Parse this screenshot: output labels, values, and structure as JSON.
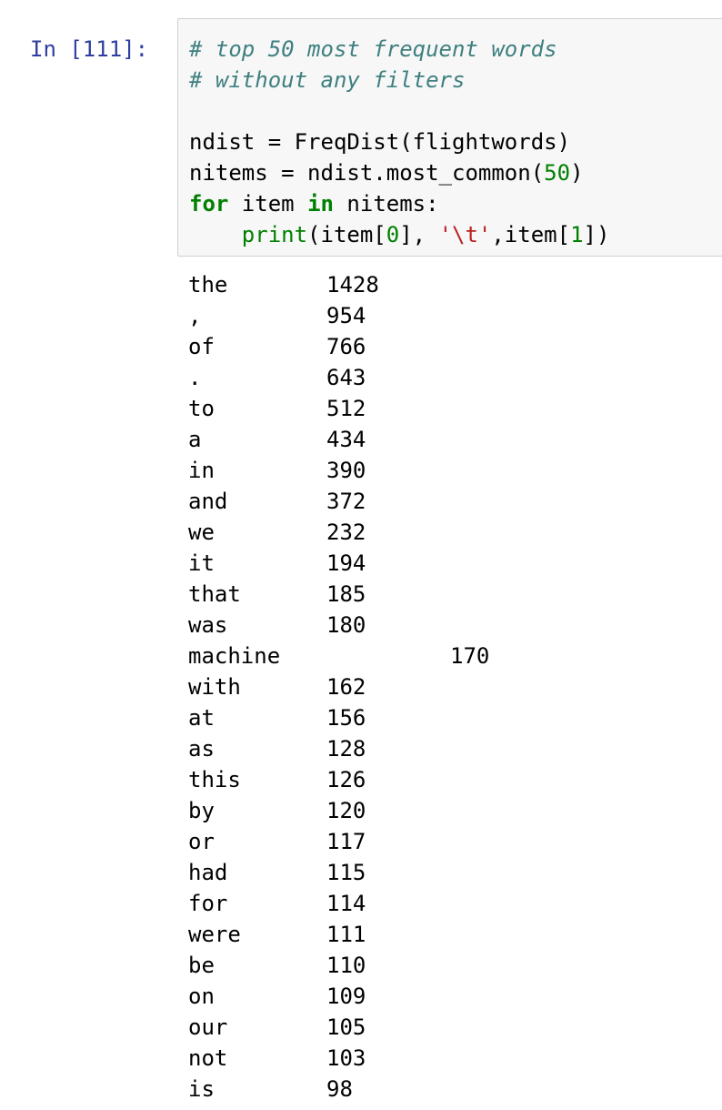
{
  "prompt": "In [111]:",
  "code": {
    "line1": "# top 50 most frequent words",
    "line2": "# without any filters",
    "line4_a": "ndist ",
    "line4_op": "=",
    "line4_b": " FreqDist(flightwords)",
    "line5_a": "nitems ",
    "line5_op": "=",
    "line5_b": " ndist.most_common(",
    "line5_num": "50",
    "line5_c": ")",
    "line6_kw1": "for",
    "line6_a": " item ",
    "line6_kw2": "in",
    "line6_b": " nitems:",
    "line7_indent": "    ",
    "line7_builtin": "print",
    "line7_a": "(item[",
    "line7_num1": "0",
    "line7_b": "], ",
    "line7_str": "'\\t'",
    "line7_c": ",item[",
    "line7_num2": "1",
    "line7_d": "])"
  },
  "output": [
    {
      "word": "the",
      "count": "1428"
    },
    {
      "word": ",",
      "count": "954"
    },
    {
      "word": "of",
      "count": "766"
    },
    {
      "word": ".",
      "count": "643"
    },
    {
      "word": "to",
      "count": "512"
    },
    {
      "word": "a",
      "count": "434"
    },
    {
      "word": "in",
      "count": "390"
    },
    {
      "word": "and",
      "count": "372"
    },
    {
      "word": "we",
      "count": "232"
    },
    {
      "word": "it",
      "count": "194"
    },
    {
      "word": "that",
      "count": "185"
    },
    {
      "word": "was",
      "count": "180"
    },
    {
      "word": "machine",
      "count": "170"
    },
    {
      "word": "with",
      "count": "162"
    },
    {
      "word": "at",
      "count": "156"
    },
    {
      "word": "as",
      "count": "128"
    },
    {
      "word": "this",
      "count": "126"
    },
    {
      "word": "by",
      "count": "120"
    },
    {
      "word": "or",
      "count": "117"
    },
    {
      "word": "had",
      "count": "115"
    },
    {
      "word": "for",
      "count": "114"
    },
    {
      "word": "were",
      "count": "111"
    },
    {
      "word": "be",
      "count": "110"
    },
    {
      "word": "on",
      "count": "109"
    },
    {
      "word": "our",
      "count": "105"
    },
    {
      "word": "not",
      "count": "103"
    },
    {
      "word": "is",
      "count": "98"
    }
  ]
}
